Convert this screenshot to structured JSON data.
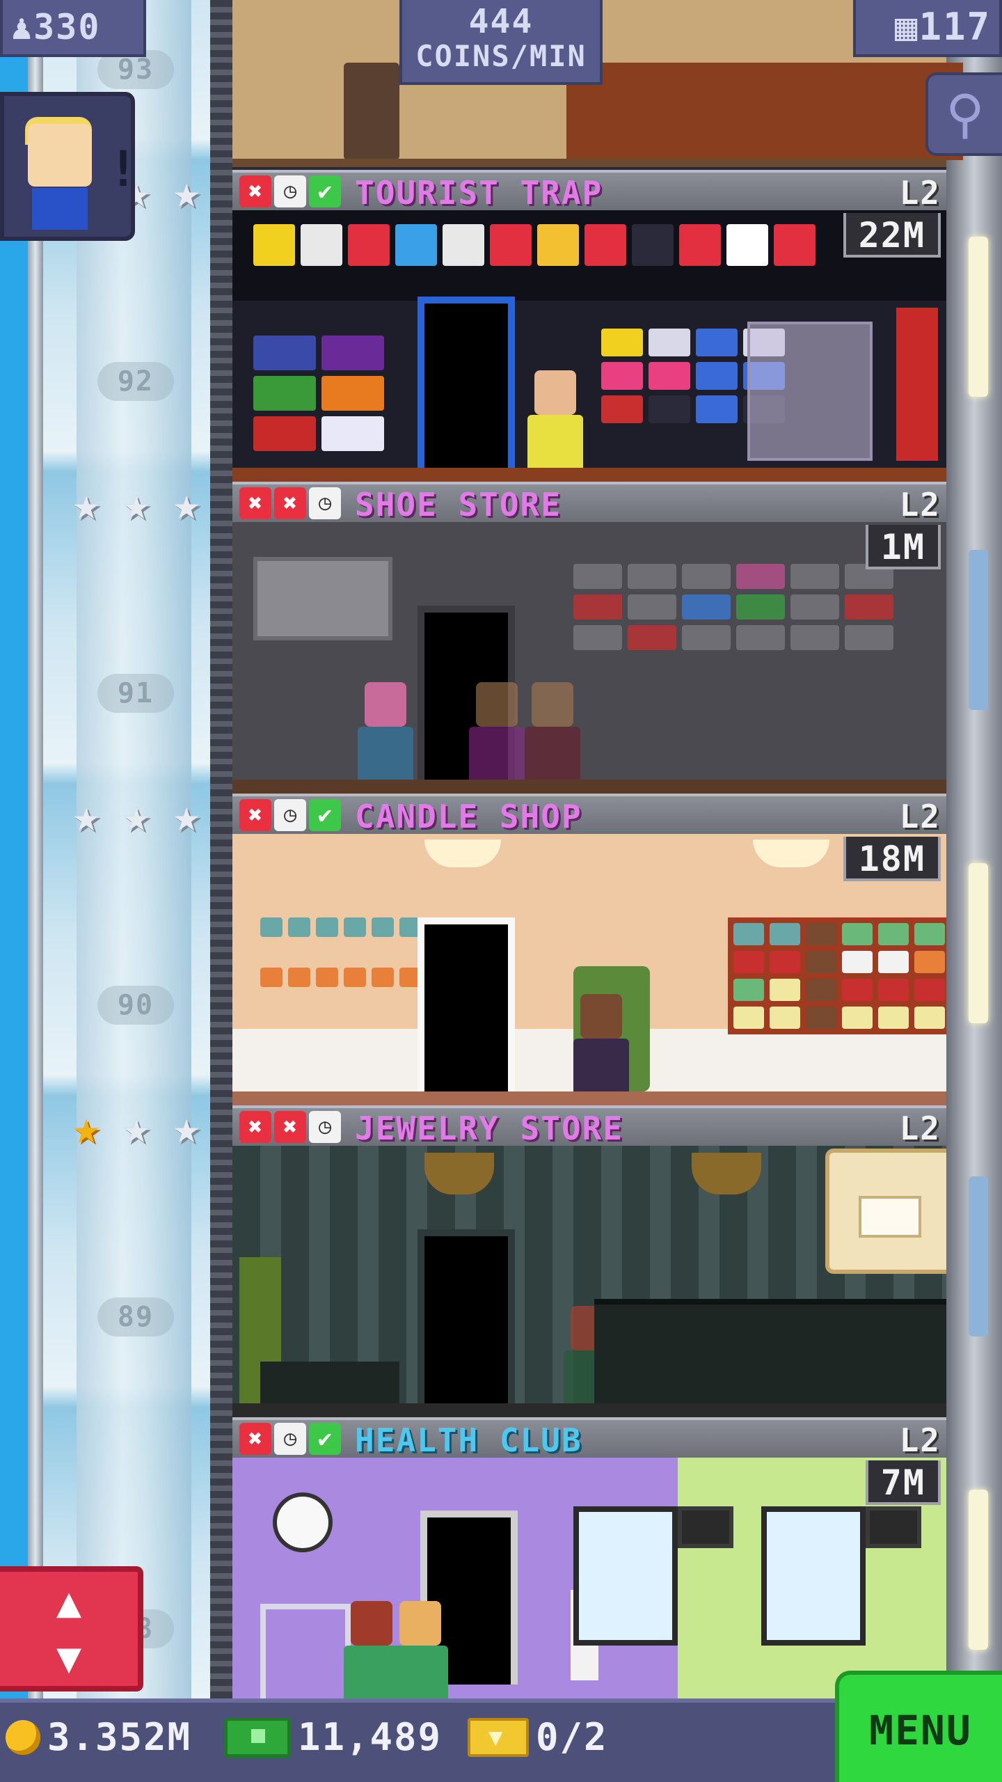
{
  "hud": {
    "population": "330",
    "coins_per_min_value": "444",
    "coins_per_min_label": "COINS/MIN",
    "floor_count": "117"
  },
  "shaft": {
    "floor_numbers": [
      "93",
      "92",
      "91",
      "90",
      "89",
      "88"
    ]
  },
  "floors": [
    {
      "name": "TOURIST TRAP",
      "level": "L2",
      "stock": "22M",
      "status": [
        "x",
        "clock",
        "check"
      ],
      "stars": 3,
      "gold_stars": 0,
      "color": "#e27ae8"
    },
    {
      "name": "SHOE STORE",
      "level": "L2",
      "stock": "1M",
      "status": [
        "x",
        "x",
        "clock"
      ],
      "stars": 3,
      "gold_stars": 0,
      "color": "#e27ae8"
    },
    {
      "name": "CANDLE SHOP",
      "level": "L2",
      "stock": "18M",
      "status": [
        "x",
        "clock",
        "check"
      ],
      "stars": 3,
      "gold_stars": 0,
      "color": "#e27ae8"
    },
    {
      "name": "JEWELRY STORE",
      "level": "L2",
      "stock": "",
      "status": [
        "x",
        "x",
        "clock"
      ],
      "stars": 3,
      "gold_stars": 1,
      "color": "#e27ae8"
    },
    {
      "name": "HEALTH CLUB",
      "level": "L2",
      "stock": "7M",
      "status": [
        "x",
        "clock",
        "check"
      ],
      "stars": 0,
      "gold_stars": 0,
      "color": "#4fc8f0"
    }
  ],
  "bottom_bar": {
    "coins": "3.352M",
    "tower_bux": "11,489",
    "tickets": "0/2",
    "menu_label": "MENU"
  },
  "icons": {
    "population": "person-icon",
    "floors": "building-icon",
    "search": "magnifier-icon",
    "elevator": "up-down-arrows-icon",
    "coins": "coin-icon",
    "bux": "cash-icon",
    "tickets": "ticket-icon"
  }
}
